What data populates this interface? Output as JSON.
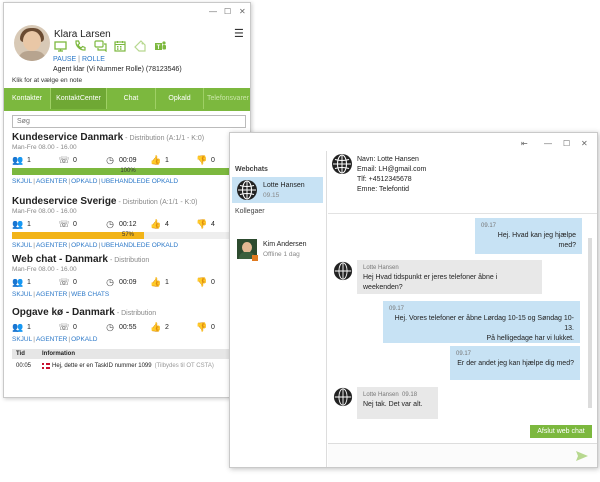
{
  "agent": {
    "name": "Klara Larsen",
    "pause_label": "PAUSE",
    "role_label": "ROLLE",
    "link_sep": "|",
    "status": "Agent klar (Vi Nummer Rolle) (78123546)",
    "note_hint": "Klik for at vælge en note"
  },
  "icons": [
    "monitor-icon",
    "phone-icon",
    "chat-icon",
    "calendar-icon",
    "tag-icon",
    "teams-icon"
  ],
  "tabs": [
    {
      "label": "Kontakter",
      "active": false,
      "disabled": false
    },
    {
      "label": "KontaktCenter",
      "active": true,
      "disabled": false
    },
    {
      "label": "Chat",
      "active": false,
      "disabled": false
    },
    {
      "label": "Opkald",
      "active": false,
      "disabled": false
    },
    {
      "label": "Telefonsvarer",
      "active": false,
      "disabled": true
    }
  ],
  "search": {
    "placeholder": "Søg"
  },
  "queues": [
    {
      "title": "Kundeservice Danmark",
      "dist": "- Distribution (A:1/1 - K:0)",
      "hours": "Man-Fre 08.00 - 16.00",
      "stats": [
        "1",
        "0",
        "00:09",
        "1",
        "0"
      ],
      "bar": {
        "percent": 100,
        "label": "100%",
        "color": "#7cb83e"
      },
      "links": [
        "SKJUL",
        "AGENTER",
        "OPKALD",
        "UBEHANDLEDE OPKALD"
      ]
    },
    {
      "title": "Kundeservice Sverige",
      "dist": "- Distribution (A:1/1 - K:0)",
      "hours": "Man-Fre 08.00 - 16.00",
      "stats": [
        "1",
        "0",
        "00:12",
        "4",
        "4"
      ],
      "bar": {
        "percent": 57,
        "label": "57%",
        "color": "#f2b418"
      },
      "links": [
        "SKJUL",
        "AGENTER",
        "OPKALD",
        "UBEHANDLEDE OPKALD"
      ]
    },
    {
      "title": "Web chat - Danmark",
      "dist": "- Distribution",
      "hours": "Man-Fre 08.00 - 16.00",
      "stats": [
        "1",
        "0",
        "00:09",
        "1",
        "0"
      ],
      "bar": null,
      "links": [
        "SKJUL",
        "AGENTER",
        "WEB CHATS"
      ]
    },
    {
      "title": "Opgave kø - Danmark",
      "dist": "- Distribution",
      "hours": "",
      "stats": [
        "1",
        "0",
        "00:55",
        "2",
        "0"
      ],
      "bar": null,
      "links": [
        "SKJUL",
        "AGENTER",
        "OPKALD"
      ]
    }
  ],
  "history": {
    "col_time": "Tid",
    "col_info": "Information",
    "rows": [
      {
        "time": "00:05",
        "info": "Hej, dette er en TaskID nummer 1099",
        "extra": "(Tilbydes til OT CSTA)"
      }
    ]
  },
  "chat_window": {
    "webchats_header": "Webchats",
    "colleagues_header": "Kollegaer",
    "active_chat": {
      "name": "Lotte Hansen",
      "time": "09.15"
    },
    "colleague": {
      "name": "Kim Andersen",
      "status": "Offline 1 dag"
    },
    "contact_info": [
      "Navn: Lotte Hansen",
      "Email: LH@gmail.com",
      "Tlf: +4512345678",
      "Emne: Telefontid"
    ],
    "messages": [
      {
        "dir": "out",
        "time": "09.17",
        "text": "Hej. Hvad kan jeg hjælpe med?"
      },
      {
        "dir": "in",
        "sender": "Lotte Hansen",
        "time": "09.17",
        "text": "Hej Hvad tidspunkt er jeres telefoner åbne i weekenden?"
      },
      {
        "dir": "out",
        "time": "09.17",
        "text": "Hej. Vores telefoner er åbne Lørdag 10-15 og Søndag 10-13.",
        "text2": "På helligedage har vi lukket."
      },
      {
        "dir": "out",
        "time": "09.17",
        "text": "Er der andet jeg kan hjælpe dig med?"
      },
      {
        "dir": "in",
        "sender": "Lotte Hansen",
        "time": "09.18",
        "text": "Nej tak. Det var alt."
      }
    ],
    "end_chat_label": "Afslut web chat"
  }
}
